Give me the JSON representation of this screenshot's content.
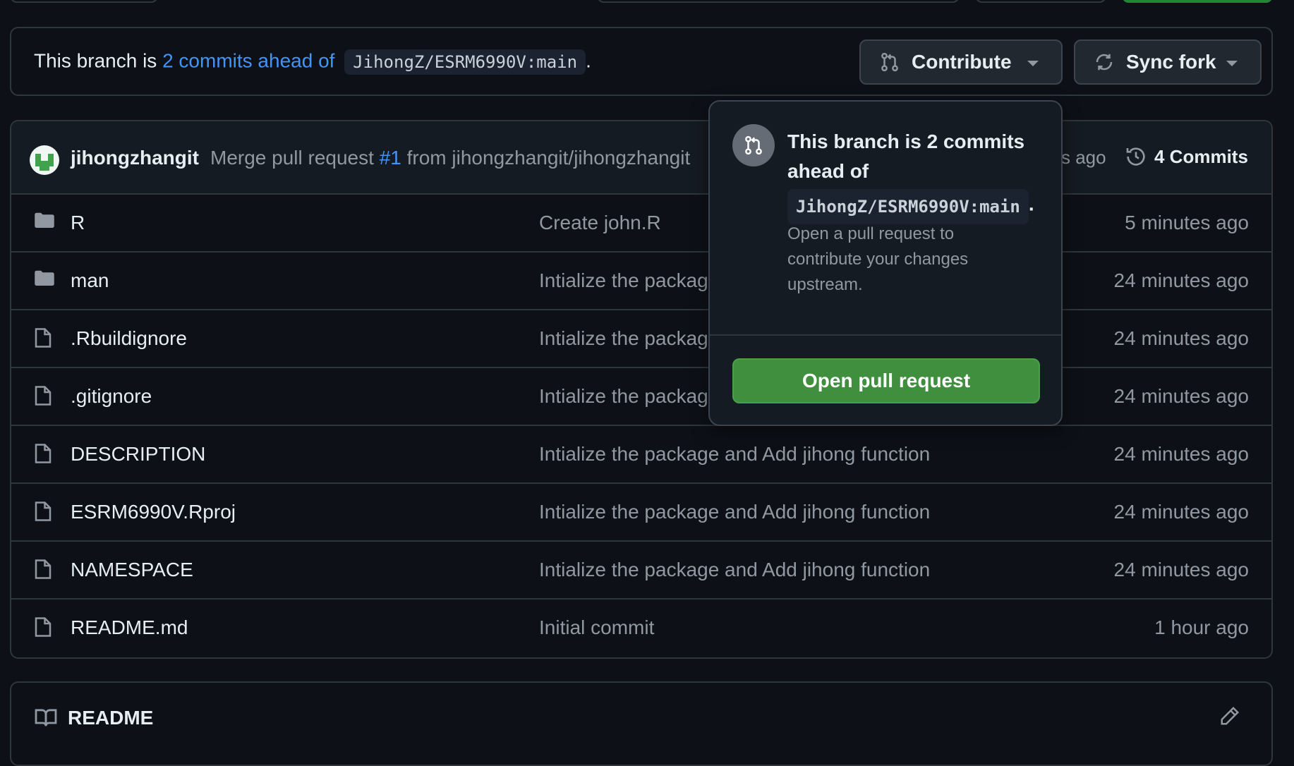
{
  "banner": {
    "prefix": "This branch is",
    "ahead_link": "2 commits ahead of",
    "upstream_ref": "JihongZ/ESRM6990V:main",
    "suffix": ".",
    "contribute_label": "Contribute",
    "sync_label": "Sync fork"
  },
  "latest_commit": {
    "author": "jihongzhangit",
    "message_prefix": "Merge pull request",
    "pr_number": "#1",
    "message_suffix": "from jihongzhangit/jihongzhangit",
    "time_stub": "s ago",
    "commits_count": "4 Commits"
  },
  "files": [
    {
      "name": "R",
      "type": "folder",
      "message": "Create john.R",
      "time": "5 minutes ago"
    },
    {
      "name": "man",
      "type": "folder",
      "message": "Intialize the packag",
      "time": "24 minutes ago"
    },
    {
      "name": ".Rbuildignore",
      "type": "file",
      "message": "Intialize the packag",
      "time": "24 minutes ago"
    },
    {
      "name": ".gitignore",
      "type": "file",
      "message": "Intialize the packag",
      "time": "24 minutes ago"
    },
    {
      "name": "DESCRIPTION",
      "type": "file",
      "message": "Intialize the package and Add jihong function",
      "time": "24 minutes ago"
    },
    {
      "name": "ESRM6990V.Rproj",
      "type": "file",
      "message": "Intialize the package and Add jihong function",
      "time": "24 minutes ago"
    },
    {
      "name": "NAMESPACE",
      "type": "file",
      "message": "Intialize the package and Add jihong function",
      "time": "24 minutes ago"
    },
    {
      "name": "README.md",
      "type": "file",
      "message": "Initial commit",
      "time": "1 hour ago"
    }
  ],
  "readme": {
    "title": "README"
  },
  "popover": {
    "title": "This branch is 2 commits ahead of",
    "ref": "JihongZ/ESRM6990V:main",
    "ref_suffix": ".",
    "description": "Open a pull request to contribute your changes upstream.",
    "button_label": "Open pull request"
  },
  "colors": {
    "accent_link": "#4493f8",
    "primary_button": "#3f8f3f",
    "background": "#0d1117"
  }
}
